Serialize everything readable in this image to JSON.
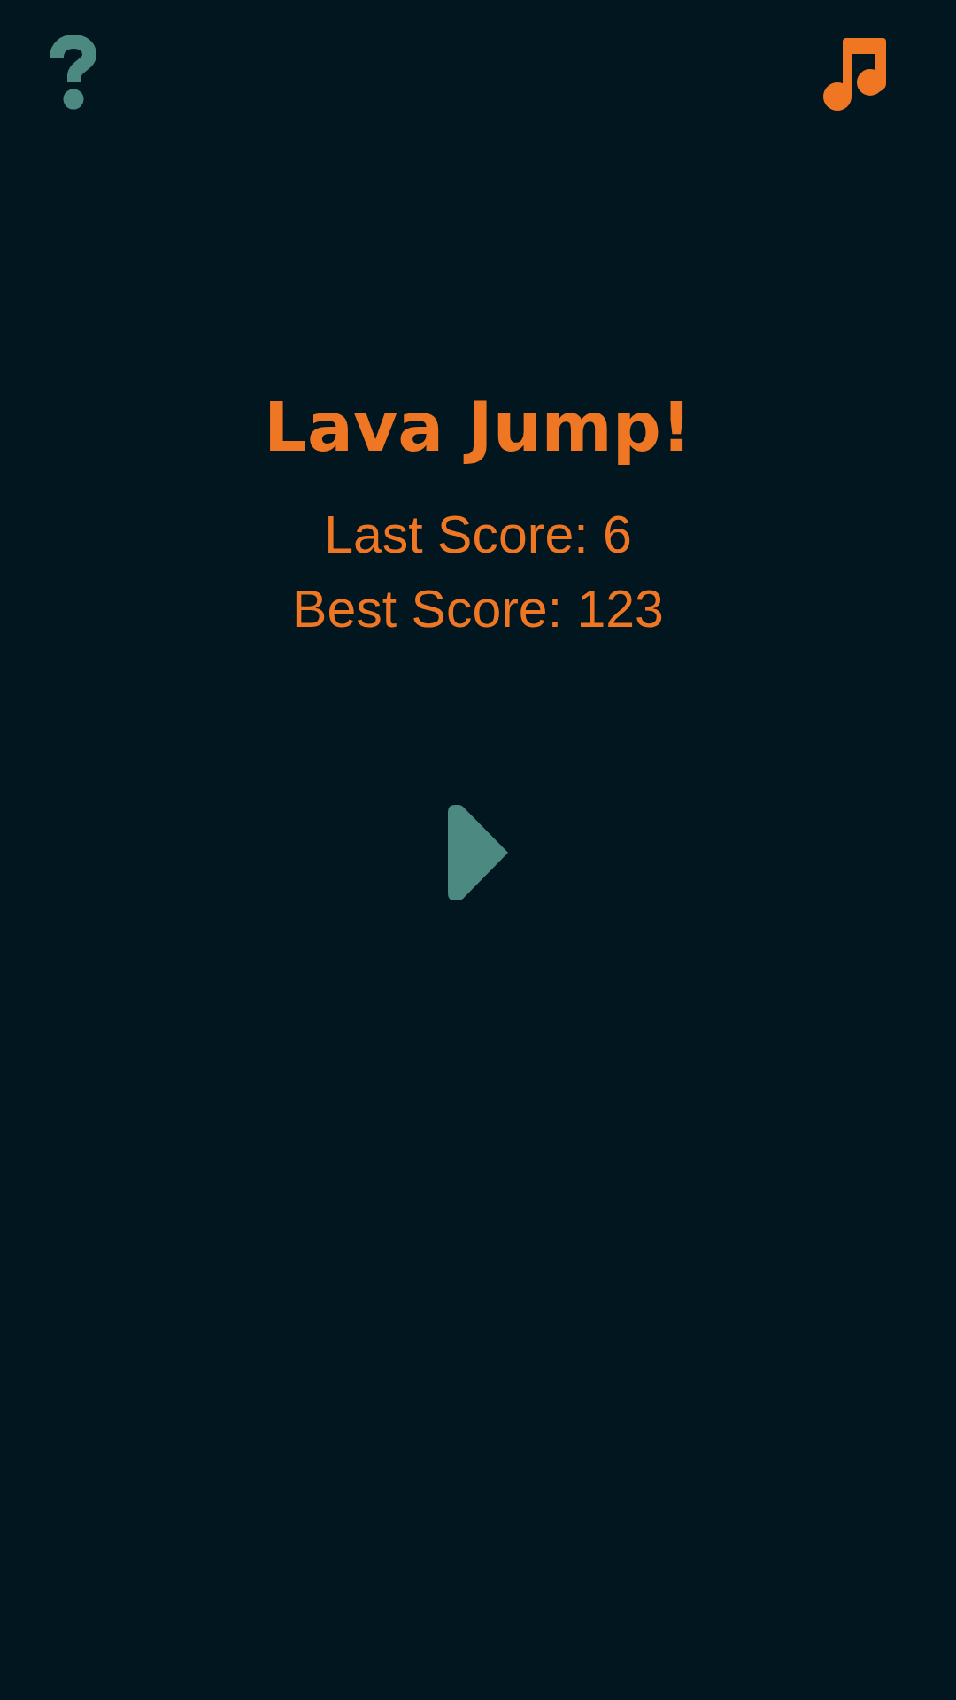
{
  "title": "Lava Jump!",
  "scores": [
    "Last Score: 6",
    "Best Score: 123"
  ]
}
